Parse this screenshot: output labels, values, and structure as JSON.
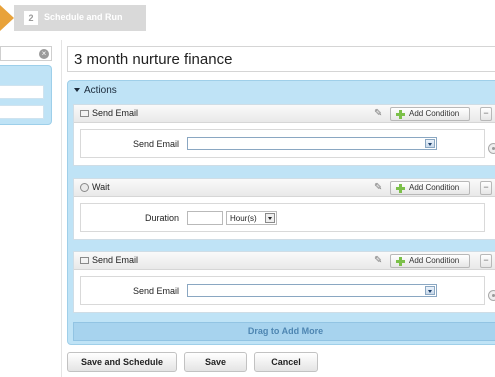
{
  "wizard": {
    "step2_number": "2",
    "step2_label": "Schedule and Run"
  },
  "left": {
    "search_placeholder": ""
  },
  "campaign_name": "3 month nurture finance",
  "actions": {
    "header": "Actions",
    "add_condition_label": "Add Condition",
    "drag_label": "Drag to Add More",
    "blocks": [
      {
        "title": "Send Email",
        "field_label": "Send Email",
        "value": ""
      },
      {
        "title": "Wait",
        "field_label": "Duration",
        "duration_value": "",
        "unit": "Hour(s)"
      },
      {
        "title": "Send Email",
        "field_label": "Send Email",
        "value": ""
      }
    ]
  },
  "buttons": {
    "save_schedule": "Save and Schedule",
    "save": "Save",
    "cancel": "Cancel"
  }
}
